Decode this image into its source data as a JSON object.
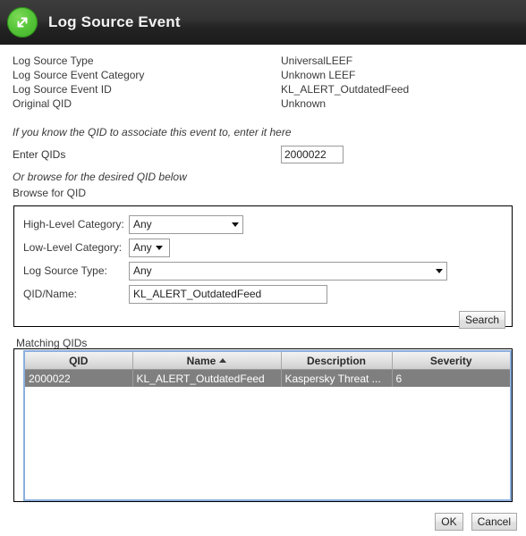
{
  "window": {
    "title": "Log Source Event",
    "icon": "expand-arrows-icon",
    "header_bg_top": "#3d3d3d",
    "header_bg_bottom": "#1b1b1b",
    "icon_color": "#57c63a"
  },
  "details": [
    {
      "label": "Log Source Type",
      "value": "UniversalLEEF"
    },
    {
      "label": "Log Source Event Category",
      "value": "Unknown LEEF"
    },
    {
      "label": "Log Source Event ID",
      "value": "KL_ALERT_OutdatedFeed"
    },
    {
      "label": "Original QID",
      "value": "Unknown"
    }
  ],
  "qid_entry": {
    "hint_top": "If you know the QID to associate this event to, enter it here",
    "enter_label": "Enter QIDs",
    "enter_value": "2000022",
    "enter_placeholder": "",
    "hint_mid": "Or browse for the desired QID below",
    "browse_label": "Browse for QID"
  },
  "search_form": {
    "high_level_category": {
      "label": "High-Level Category:",
      "value": "Any"
    },
    "low_level_category": {
      "label": "Low-Level Category:",
      "value": "Any"
    },
    "log_source_type": {
      "label": "Log Source Type:",
      "value": "Any"
    },
    "qid_name": {
      "label": "QID/Name:",
      "value": "KL_ALERT_OutdatedFeed",
      "placeholder": ""
    },
    "search_button": "Search"
  },
  "results": {
    "title": "Matching QIDs",
    "columns": [
      "QID",
      "Name",
      "Description",
      "Severity"
    ],
    "sorted_column": "Name",
    "sort_direction": "asc",
    "rows": [
      {
        "qid": "2000022",
        "name": "KL_ALERT_OutdatedFeed",
        "description": "Kaspersky Threat ...",
        "severity": "6",
        "selected": true
      }
    ],
    "border_color": "#8baedd",
    "selected_row_color": "#7f7f7f"
  },
  "footer": {
    "ok_label": "OK",
    "cancel_label": "Cancel"
  }
}
